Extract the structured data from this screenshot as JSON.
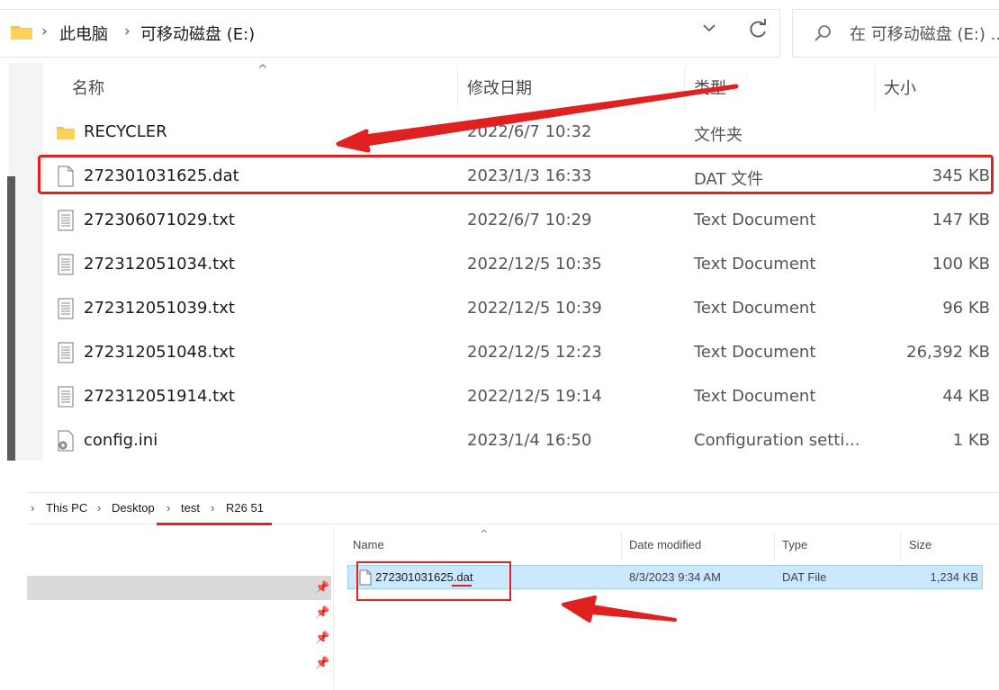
{
  "top_window": {
    "address_path": [
      "此电脑",
      "可移动磁盘 (E:)"
    ],
    "search_placeholder": "在 可移动磁盘 (E:) ...",
    "columns": [
      "名称",
      "修改日期",
      "类型",
      "大小"
    ],
    "files": [
      {
        "name": "RECYCLER",
        "date": "2022/6/7 10:32",
        "type": "文件夹",
        "size": "",
        "icon": "folder-icon"
      },
      {
        "name": "272301031625.dat",
        "date": "2023/1/3 16:33",
        "type": "DAT 文件",
        "size": "345 KB",
        "icon": "file-icon",
        "highlighted": true
      },
      {
        "name": "272306071029.txt",
        "date": "2022/6/7 10:29",
        "type": "Text Document",
        "size": "147 KB",
        "icon": "text-file-icon"
      },
      {
        "name": "272312051034.txt",
        "date": "2022/12/5 10:35",
        "type": "Text Document",
        "size": "100 KB",
        "icon": "text-file-icon"
      },
      {
        "name": "272312051039.txt",
        "date": "2022/12/5 10:39",
        "type": "Text Document",
        "size": "96 KB",
        "icon": "text-file-icon"
      },
      {
        "name": "272312051048.txt",
        "date": "2022/12/5 12:23",
        "type": "Text Document",
        "size": "26,392 KB",
        "icon": "text-file-icon"
      },
      {
        "name": "272312051914.txt",
        "date": "2022/12/5 19:14",
        "type": "Text Document",
        "size": "44 KB",
        "icon": "text-file-icon"
      },
      {
        "name": "config.ini",
        "date": "2023/1/4 16:50",
        "type": "Configuration setti...",
        "size": "1 KB",
        "icon": "config-file-icon"
      }
    ]
  },
  "bottom_window": {
    "breadcrumb": [
      "This PC",
      "Desktop",
      "test",
      "R26 51"
    ],
    "columns": [
      "Name",
      "Date modified",
      "Type",
      "Size"
    ],
    "files": [
      {
        "name": "272301031625.dat",
        "date": "8/3/2023 9:34 AM",
        "type": "DAT File",
        "size": "1,234 KB",
        "selected": true
      }
    ]
  },
  "colors": {
    "annotation_red": "#e02121",
    "selection_blue": "#cce8ff",
    "folder_yellow": "#f8c443"
  }
}
